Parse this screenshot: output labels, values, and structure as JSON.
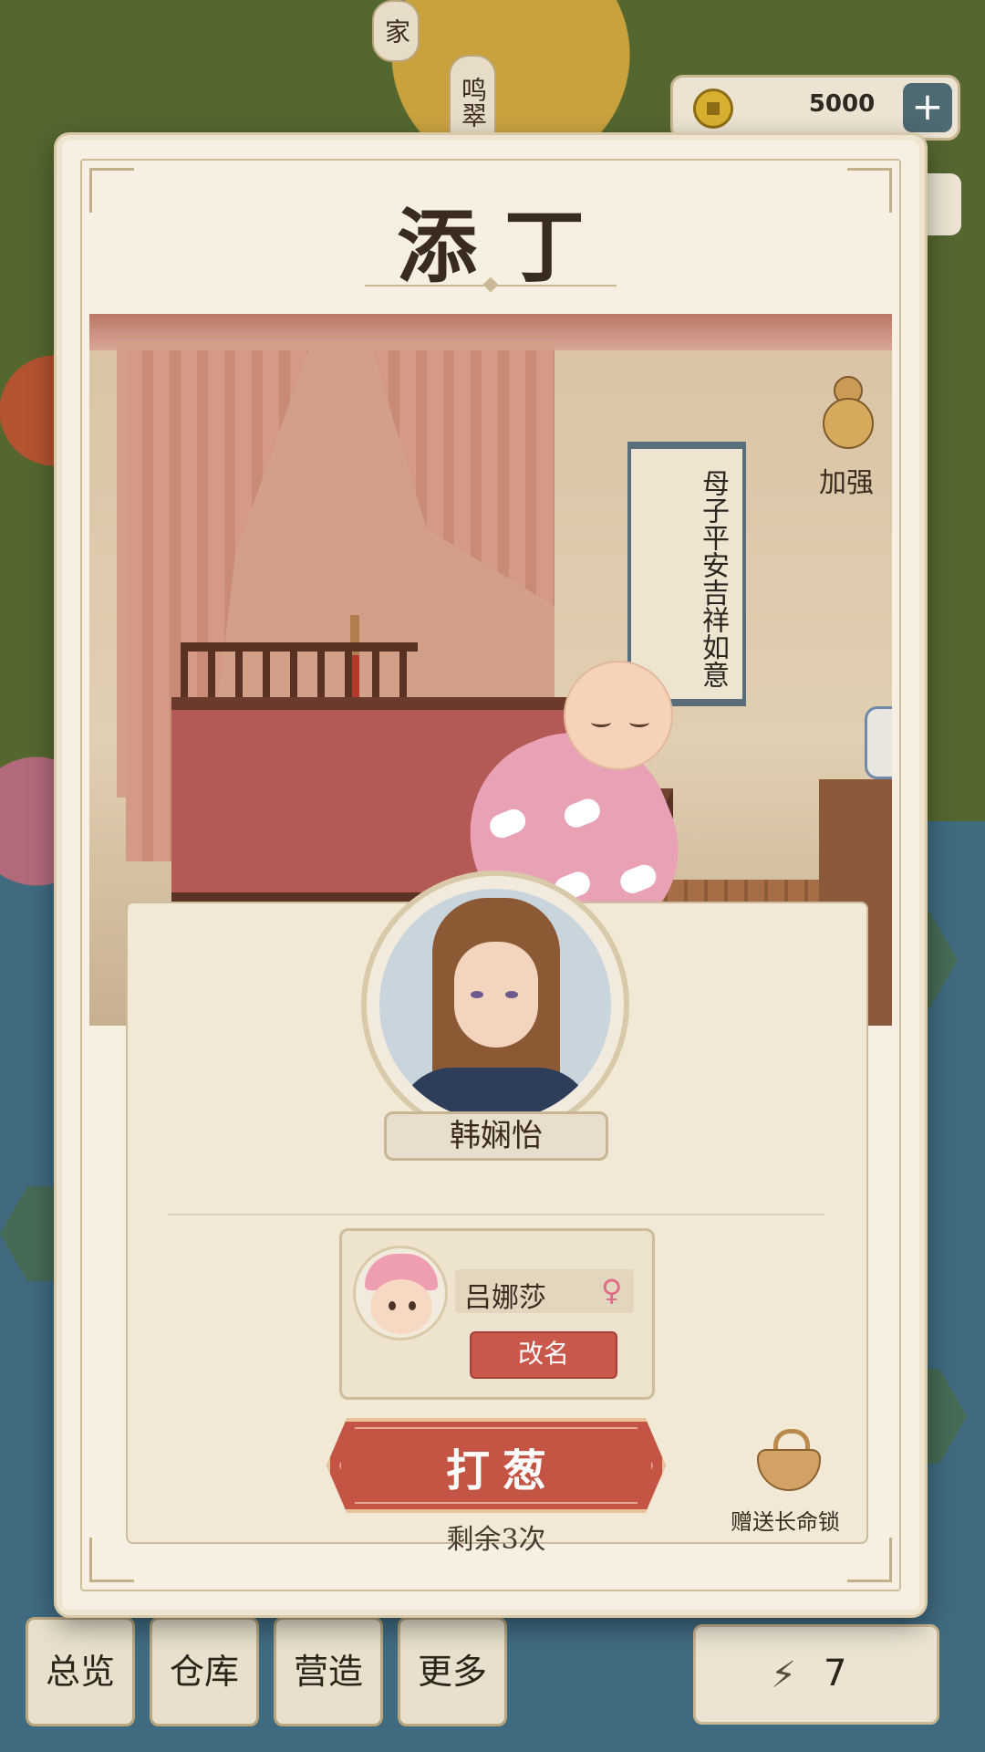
{
  "background": {
    "map_tags": [
      "家",
      "鸣翠"
    ],
    "currency": {
      "value": "5000",
      "plus": "+"
    },
    "nav": [
      "总览",
      "仓库",
      "营造",
      "更多"
    ],
    "energy": {
      "icon": "lightning-icon",
      "value": "7"
    }
  },
  "modal": {
    "title": "添丁",
    "scroll_text": "母子平安吉祥如意",
    "enhance_label": "加强",
    "mother_name": "韩娴怡",
    "child": {
      "name": "吕娜莎",
      "gender_symbol": "♀",
      "rename_label": "改名"
    },
    "action_label": "打葱",
    "remaining_label": "剩余3次",
    "gift_label": "赠送长命锁"
  },
  "colors": {
    "accent_red": "#c45444",
    "paper": "#f7f0e2",
    "gender_female": "#e06a88"
  }
}
